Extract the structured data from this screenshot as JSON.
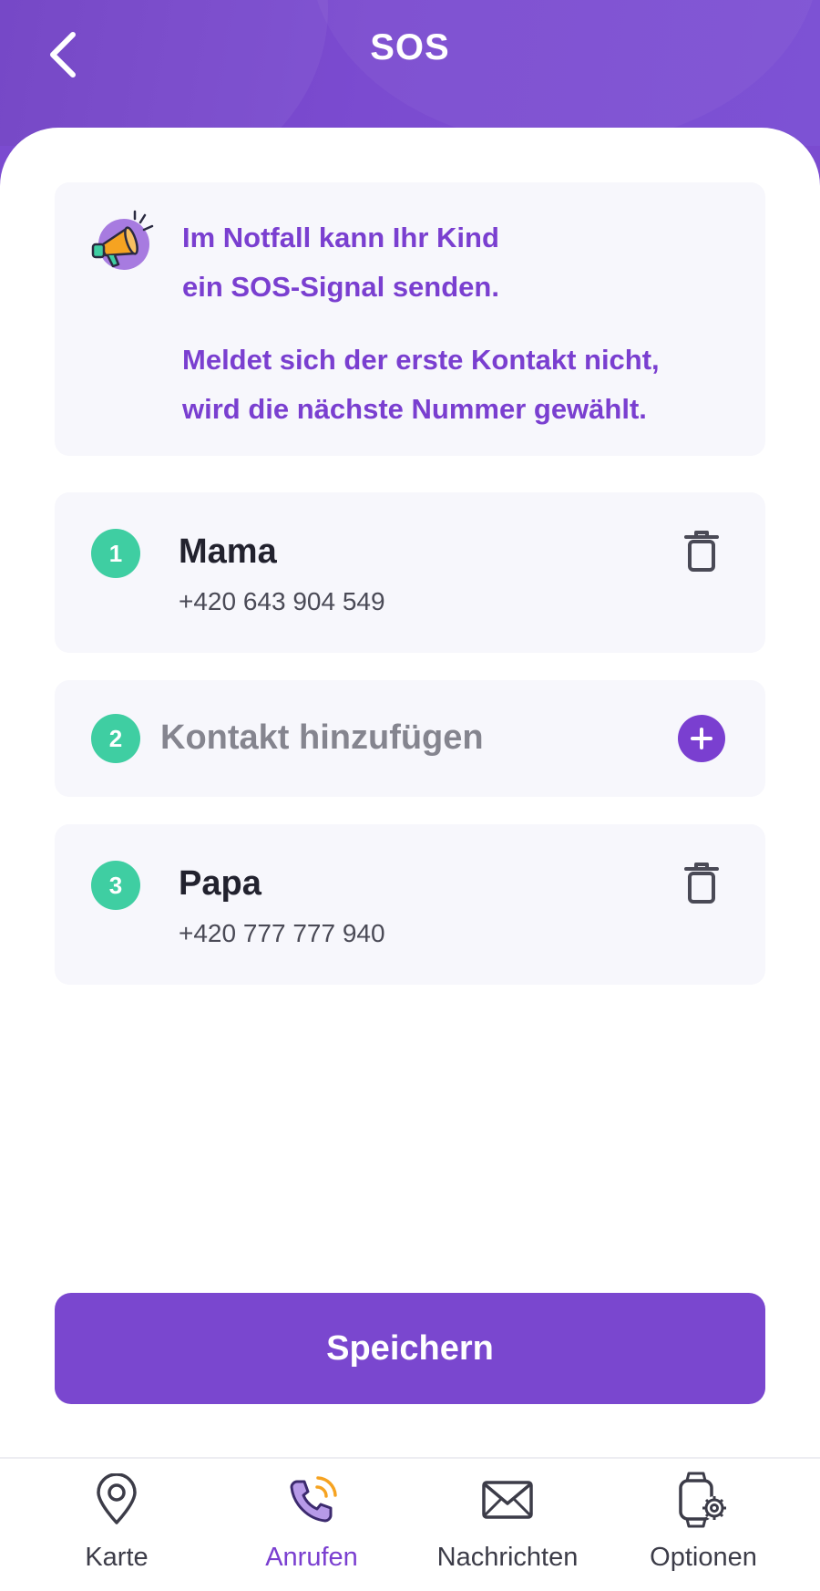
{
  "header": {
    "title": "SOS",
    "back_icon": "chevron-left-icon"
  },
  "info": {
    "icon": "megaphone-icon",
    "line1": "Im Notfall kann Ihr Kind",
    "line2": "ein SOS-Signal senden.",
    "line3": "Meldet sich der erste Kontakt nicht,",
    "line4": "wird die nächste Nummer gewählt."
  },
  "contacts": [
    {
      "number": "1",
      "name": "Mama",
      "phone": "+420 643 904 549",
      "action_icon": "trash-icon"
    },
    {
      "number": "2",
      "placeholder": "Kontakt hinzufügen",
      "action_icon": "plus-icon"
    },
    {
      "number": "3",
      "name": "Papa",
      "phone": "+420 777 777 940",
      "action_icon": "trash-icon"
    }
  ],
  "save_label": "Speichern",
  "nav": {
    "items": [
      {
        "label": "Karte",
        "icon": "map-pin-icon",
        "active": false
      },
      {
        "label": "Anrufen",
        "icon": "phone-ringing-icon",
        "active": true
      },
      {
        "label": "Nachrichten",
        "icon": "envelope-icon",
        "active": false
      },
      {
        "label": "Optionen",
        "icon": "watch-settings-icon",
        "active": false
      }
    ]
  },
  "colors": {
    "brand": "#7a47cf",
    "badge": "#3fcea2",
    "card": "#f7f7fc",
    "accent_orange": "#f6a321"
  }
}
